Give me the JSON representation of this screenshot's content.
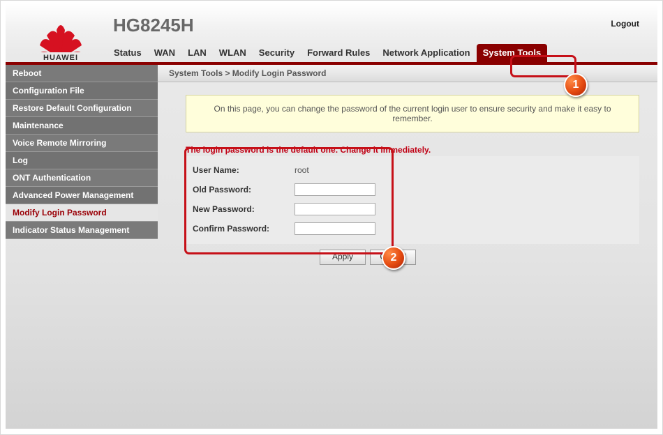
{
  "header": {
    "brand": "HUAWEI",
    "model": "HG8245H",
    "logout": "Logout"
  },
  "top_nav": {
    "items": [
      {
        "label": "Status"
      },
      {
        "label": "WAN"
      },
      {
        "label": "LAN"
      },
      {
        "label": "WLAN"
      },
      {
        "label": "Security"
      },
      {
        "label": "Forward Rules"
      },
      {
        "label": "Network Application"
      },
      {
        "label": "System Tools"
      }
    ],
    "active_index": 7
  },
  "sidebar": {
    "items": [
      {
        "label": "Reboot"
      },
      {
        "label": "Configuration File"
      },
      {
        "label": "Restore Default Configuration"
      },
      {
        "label": "Maintenance"
      },
      {
        "label": "Voice Remote Mirroring"
      },
      {
        "label": "Log"
      },
      {
        "label": "ONT Authentication"
      },
      {
        "label": "Advanced Power Management"
      },
      {
        "label": "Modify Login Password"
      },
      {
        "label": "Indicator Status Management"
      }
    ],
    "active_index": 8
  },
  "breadcrumb": "System Tools > Modify Login Password",
  "info_banner": "On this page, you can change the password of the current login user to ensure security and make it easy to remember.",
  "warning": "The login password is the default one. Change it immediately.",
  "form": {
    "user_name_label": "User Name:",
    "user_name_value": "root",
    "old_password_label": "Old Password:",
    "new_password_label": "New Password:",
    "confirm_password_label": "Confirm Password:",
    "apply": "Apply",
    "cancel": "Cancel"
  },
  "annotations": {
    "callout1": "1",
    "callout2": "2"
  }
}
